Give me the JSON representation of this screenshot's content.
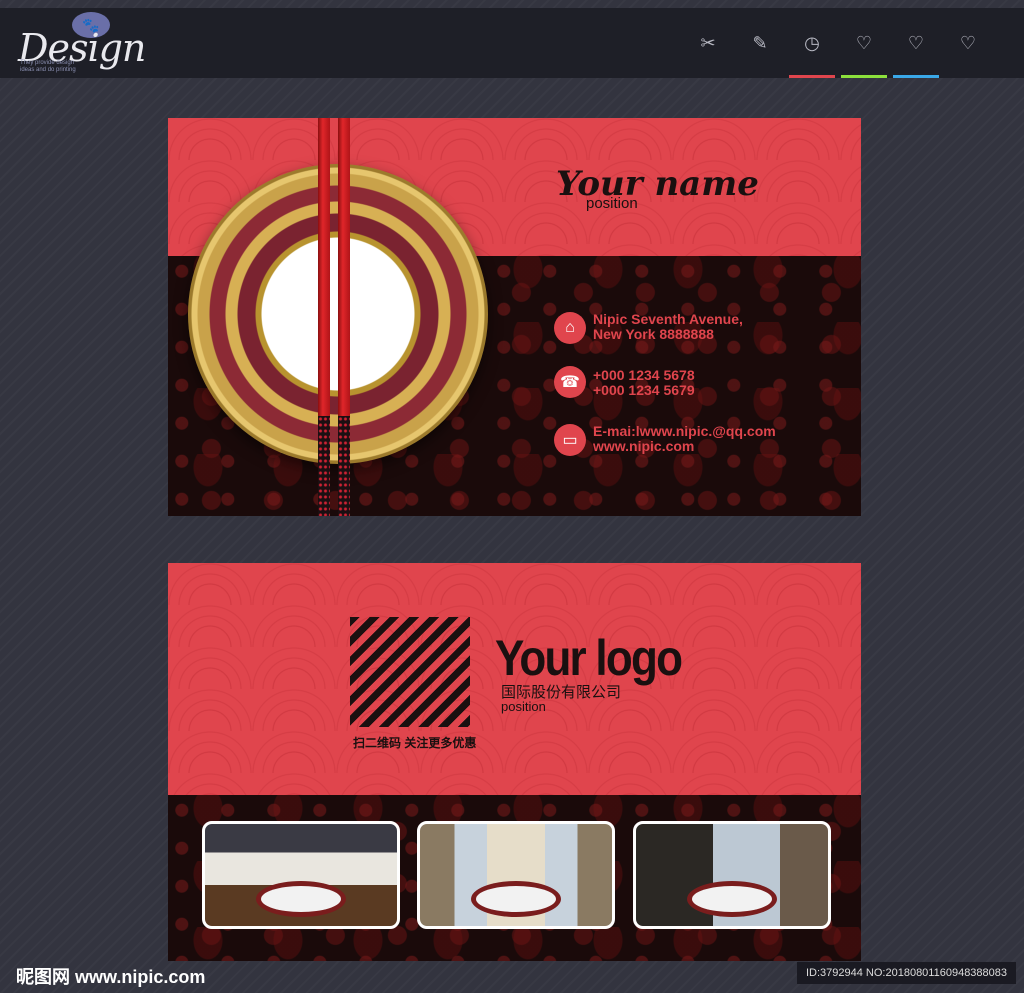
{
  "header": {
    "logo_text": "Design",
    "logo_tagline": "They provide design\nideas and do printing",
    "tools": [
      {
        "icon": "scissors-icon",
        "glyph": "✂",
        "bar": ""
      },
      {
        "icon": "pencil-icon",
        "glyph": "✎",
        "bar": ""
      },
      {
        "icon": "clock-icon",
        "glyph": "◷",
        "bar": "#e0454d"
      },
      {
        "icon": "heart-icon",
        "glyph": "♡",
        "bar": "#8ce03c"
      },
      {
        "icon": "heart-add-icon",
        "glyph": "♡",
        "bar": "#3aa8e8"
      },
      {
        "icon": "heart-remove-icon",
        "glyph": "♡",
        "bar": ""
      }
    ]
  },
  "card_front": {
    "name": "Your name",
    "position": "position",
    "address": [
      "Nipic Seventh Avenue,",
      "New York 8888888"
    ],
    "phones": [
      "+000 1234 5678",
      "+000 1234 5679"
    ],
    "email": [
      "E-mai:lwww.nipic.@qq.com",
      "www.nipic.com"
    ]
  },
  "card_back": {
    "logo_text": "Your logo",
    "company": "国际股份有限公司",
    "position": "position",
    "qr_caption": "扫二维码  关注更多优惠"
  },
  "watermark": {
    "left": "昵图网 www.nipic.com",
    "right": "ID:3792944 NO:20180801160948388083"
  },
  "colors": {
    "accent": "#e0454d",
    "dark": "#1a0a0a",
    "page_bg": "#33343f"
  }
}
